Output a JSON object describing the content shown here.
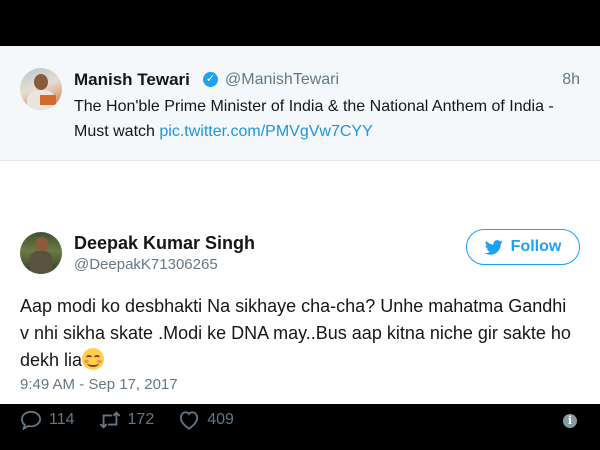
{
  "quoted_tweet": {
    "author_name": "Manish Tewari",
    "handle": "@ManishTewari",
    "time": "8h",
    "text": "The Hon'ble Prime Minister of India & the National Anthem of India - Must watch ",
    "link": "pic.twitter.com/PMVgVw7CYY"
  },
  "tweet": {
    "author_name": "Deepak Kumar Singh",
    "handle": "@DeepakK71306265",
    "follow_label": "Follow",
    "text": "Aap modi ko desbhakti Na sikhaye cha-cha? Unhe mahatma Gandhi v nhi sikha skate .Modi ke DNA may..Bus aap kitna niche gir sakte ho dekh lia",
    "emoji": "smiling-face-icon",
    "timestamp": "9:49 AM - Sep 17, 2017",
    "replies": "114",
    "retweets": "172",
    "likes": "409"
  },
  "colors": {
    "accent": "#1da1f2",
    "muted": "#657786",
    "text": "#14171a",
    "frame": "#000000"
  }
}
